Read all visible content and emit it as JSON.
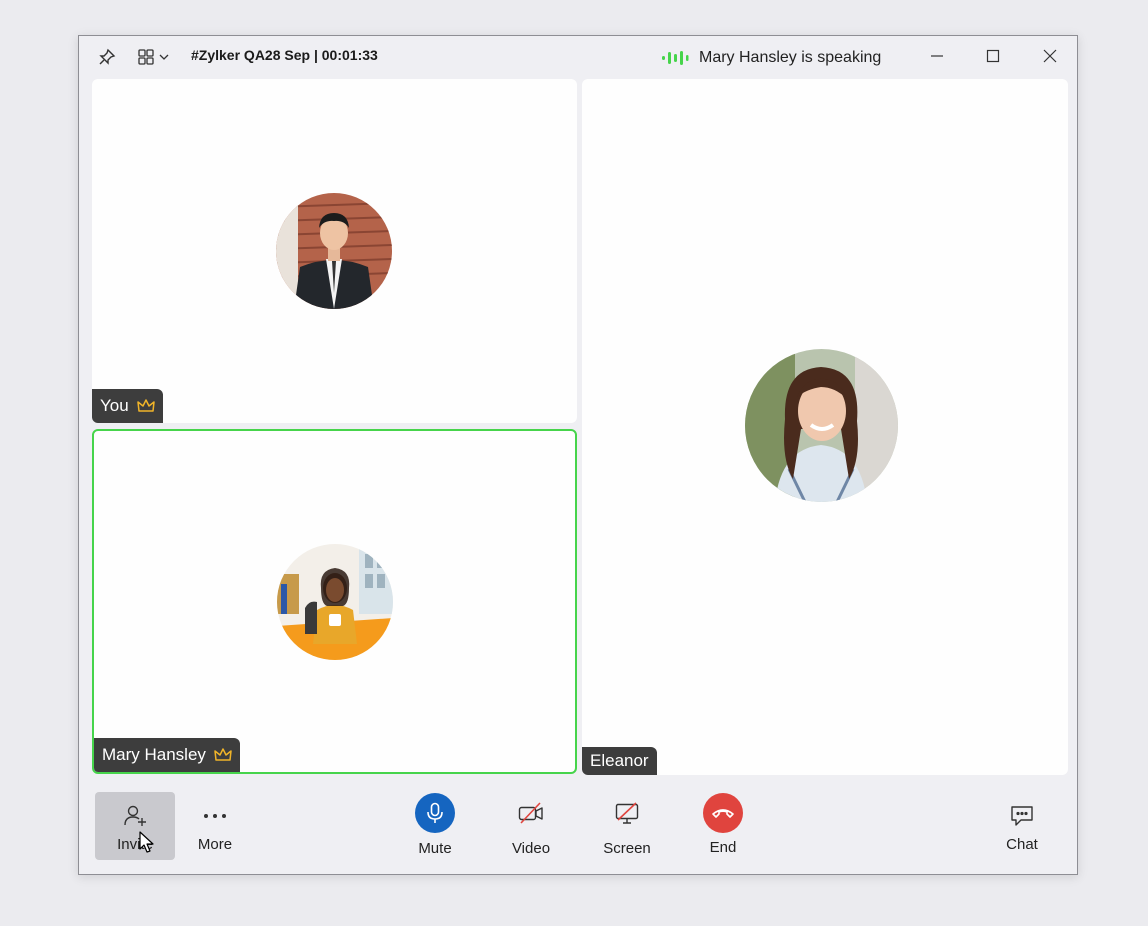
{
  "window": {
    "title": "#Zylker QA28 Sep | 00:01:33",
    "speaking_status": "Mary Hansley is speaking"
  },
  "participants": [
    {
      "name": "You",
      "host": true,
      "speaking": false
    },
    {
      "name": "Mary Hansley",
      "host": true,
      "speaking": true
    },
    {
      "name": "Eleanor",
      "host": false,
      "speaking": false
    }
  ],
  "toolbar": {
    "invite_label": "Invite",
    "more_label": "More",
    "mute_label": "Mute",
    "video_label": "Video",
    "screen_label": "Screen",
    "end_label": "End",
    "chat_label": "Chat"
  },
  "icons": {
    "pin": "pin-icon",
    "layout": "grid-layout-icon",
    "speaking": "audio-wave-icon",
    "host": "crown-icon"
  },
  "colors": {
    "active_border": "#46d44b",
    "mute_button": "#1565c0",
    "end_button": "#e0443e",
    "host_crown": "#f0b429"
  }
}
